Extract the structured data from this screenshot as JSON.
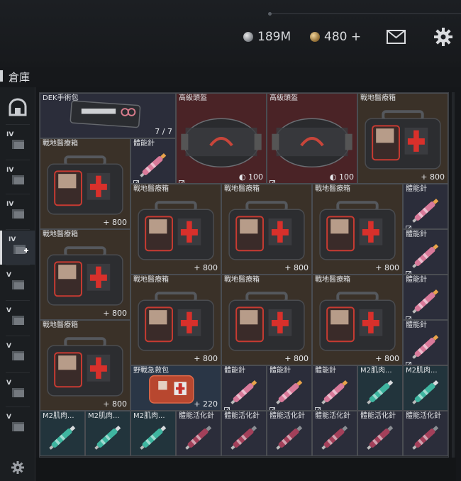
{
  "header": {
    "silver_amount": "189M",
    "gold_amount": "480 +"
  },
  "page": {
    "title": "倉庫"
  },
  "icons": {
    "silver": "silver-coin-icon",
    "gold": "gold-coin-icon",
    "mail": "mail-icon",
    "settings": "gear-icon"
  },
  "sidebar": {
    "items": [
      {
        "name": "dome-icon",
        "label": ""
      },
      {
        "name": "container-iv-icon",
        "label": "IV"
      },
      {
        "name": "container-iv-icon",
        "label": "IV"
      },
      {
        "name": "container-iv-icon",
        "label": "IV"
      },
      {
        "name": "container-iv-add-icon",
        "label": "IV"
      },
      {
        "name": "container-v-icon",
        "label": "V"
      },
      {
        "name": "container-v-icon",
        "label": "V"
      },
      {
        "name": "container-v-icon",
        "label": "V"
      },
      {
        "name": "container-v-icon",
        "label": "V"
      },
      {
        "name": "container-v-icon",
        "label": "V"
      }
    ]
  },
  "colors": {
    "medkit_bg": "#3a3128",
    "helmet_bg": "#4a2326",
    "stim_bg": "#2b2d3a",
    "m2_bg": "#22343c"
  },
  "items": [
    {
      "label": "DEK手術包",
      "value": "7 / 7",
      "kind": "surgical"
    },
    {
      "label": "高級頭盔",
      "value": "100",
      "kind": "helmet"
    },
    {
      "label": "高級頭盔",
      "value": "100",
      "kind": "helmet"
    },
    {
      "label": "戰地醫療箱",
      "value": "+ 800",
      "kind": "medkit"
    },
    {
      "label": "戰地醫療箱",
      "value": "+ 800",
      "kind": "medkit"
    },
    {
      "label": "體能針",
      "value": "",
      "kind": "stim"
    },
    {
      "label": "戰地醫療箱",
      "value": "+ 800",
      "kind": "medkit"
    },
    {
      "label": "戰地醫療箱",
      "value": "+ 800",
      "kind": "medkit"
    },
    {
      "label": "戰地醫療箱",
      "value": "+ 800",
      "kind": "medkit"
    },
    {
      "label": "體能針",
      "value": "",
      "kind": "stim"
    },
    {
      "label": "戰地醫療箱",
      "value": "+ 800",
      "kind": "medkit"
    },
    {
      "label": "體能針",
      "value": "",
      "kind": "stim"
    },
    {
      "label": "戰地醫療箱",
      "value": "+ 800",
      "kind": "medkit"
    },
    {
      "label": "戰地醫療箱",
      "value": "+ 800",
      "kind": "medkit"
    },
    {
      "label": "戰地醫療箱",
      "value": "+ 800",
      "kind": "medkit"
    },
    {
      "label": "體能針",
      "value": "",
      "kind": "stim"
    },
    {
      "label": "戰地醫療箱",
      "value": "+ 800",
      "kind": "medkit"
    },
    {
      "label": "體能針",
      "value": "",
      "kind": "stim"
    },
    {
      "label": "野戰急救包",
      "value": "+ 220",
      "kind": "ifak"
    },
    {
      "label": "體能針",
      "value": "",
      "kind": "stim"
    },
    {
      "label": "體能針",
      "value": "",
      "kind": "stim"
    },
    {
      "label": "體能針",
      "value": "",
      "kind": "stim"
    },
    {
      "label": "M2肌肉...",
      "value": "",
      "kind": "m2"
    },
    {
      "label": "M2肌肉...",
      "value": "",
      "kind": "m2"
    },
    {
      "label": "M2肌肉...",
      "value": "",
      "kind": "m2"
    },
    {
      "label": "M2肌肉...",
      "value": "",
      "kind": "m2"
    },
    {
      "label": "M2肌肉...",
      "value": "",
      "kind": "m2"
    },
    {
      "label": "體能活化針",
      "value": "",
      "kind": "stim2"
    },
    {
      "label": "體能活化針",
      "value": "",
      "kind": "stim2"
    },
    {
      "label": "體能活化針",
      "value": "",
      "kind": "stim2"
    },
    {
      "label": "體能活化針",
      "value": "",
      "kind": "stim2"
    },
    {
      "label": "體能活化針",
      "value": "",
      "kind": "stim2"
    },
    {
      "label": "體能活化針",
      "value": "",
      "kind": "stim2"
    }
  ]
}
